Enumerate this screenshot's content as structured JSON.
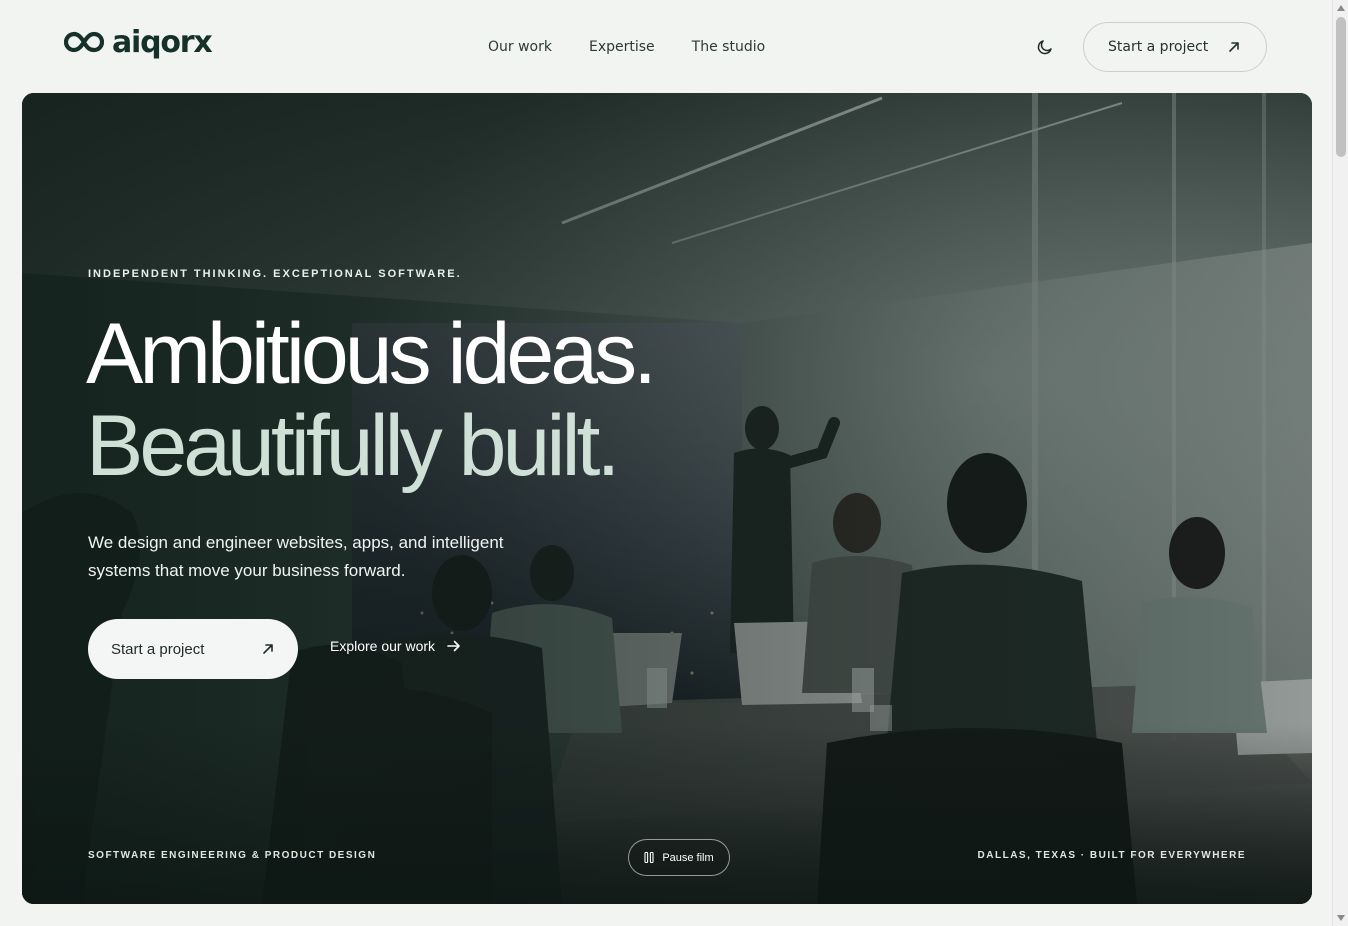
{
  "brand": {
    "name": "aiqorx",
    "logo_icon": "infinity-loop-icon"
  },
  "nav": {
    "items": [
      {
        "label": "Our work"
      },
      {
        "label": "Expertise"
      },
      {
        "label": "The studio"
      }
    ]
  },
  "header": {
    "theme_toggle_icon": "moon-icon",
    "cta_label": "Start a project",
    "cta_icon": "arrow-up-right-icon"
  },
  "hero": {
    "eyebrow": "INDEPENDENT THINKING. EXCEPTIONAL SOFTWARE.",
    "headline_line1": "Ambitious ideas.",
    "headline_line2": "Beautifully built.",
    "subtext": "We design and engineer websites, apps, and intelligent systems that move your business forward.",
    "primary_cta": {
      "label": "Start a project",
      "icon": "arrow-up-right-icon"
    },
    "secondary_cta": {
      "label": "Explore our work",
      "icon": "arrow-right-icon"
    },
    "footer_left": "SOFTWARE ENGINEERING & PRODUCT DESIGN",
    "footer_right": "DALLAS, TEXAS · BUILT FOR EVERYWHERE",
    "pause_button": {
      "label": "Pause film",
      "icon": "pause-icon"
    }
  },
  "colors": {
    "background": "#f2f4f2",
    "brand_dark": "#16312a",
    "headline_white": "#ffffff",
    "headline_mint": "#cfe0d7"
  }
}
